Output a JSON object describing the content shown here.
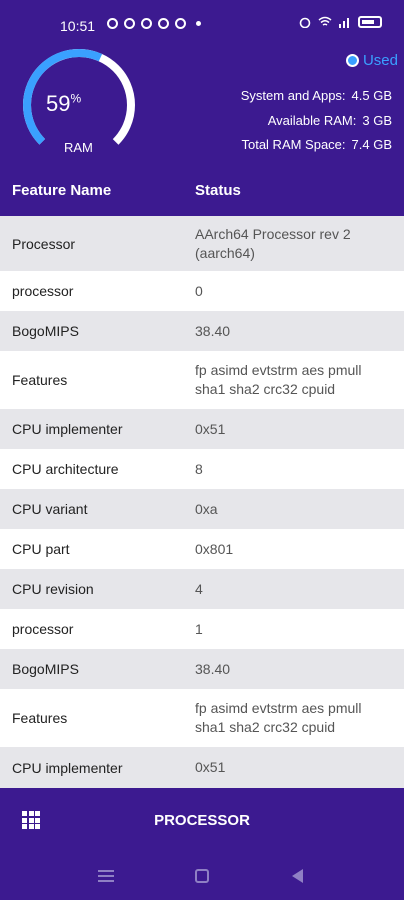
{
  "status_bar": {
    "time": "10:51",
    "icons": [
      "play-icon",
      "messenger-icon",
      "tiktok-icon",
      "instagram-icon",
      "pinterest-icon",
      "dot-icon"
    ],
    "right_icons": [
      "alarm-icon",
      "wifi-icon",
      "signal-icon",
      "battery-icon"
    ]
  },
  "ram": {
    "percent_number": "59",
    "percent_sign": "%",
    "label": "RAM",
    "used_fraction": 0.59,
    "used_label": "Used",
    "system_apps_label": "System and Apps:",
    "system_apps_value": "4.5 GB",
    "available_label": "Available RAM:",
    "available_value": "3 GB",
    "total_label": "Total RAM Space:",
    "total_value": "7.4 GB"
  },
  "table": {
    "headers": [
      "Feature Name",
      "Status"
    ],
    "rows": [
      {
        "name": "Processor",
        "value": "AArch64 Processor rev 2 (aarch64)"
      },
      {
        "name": "processor",
        "value": "0"
      },
      {
        "name": "BogoMIPS",
        "value": "38.40"
      },
      {
        "name": "Features",
        "value": "fp asimd evtstrm aes pmull sha1 sha2 crc32 cpuid"
      },
      {
        "name": "CPU implementer",
        "value": "0x51"
      },
      {
        "name": "CPU architecture",
        "value": "8"
      },
      {
        "name": "CPU variant",
        "value": "0xa"
      },
      {
        "name": "CPU part",
        "value": "0x801"
      },
      {
        "name": "CPU revision",
        "value": "4"
      },
      {
        "name": "processor",
        "value": "1"
      },
      {
        "name": "BogoMIPS",
        "value": "38.40"
      },
      {
        "name": "Features",
        "value": "fp asimd evtstrm aes pmull sha1 sha2 crc32 cpuid"
      },
      {
        "name": "CPU implementer",
        "value": "0x51"
      }
    ]
  },
  "footer": {
    "title": "PROCESSOR",
    "menu_icon": "grid-icon"
  },
  "colors": {
    "primary": "#3c1a90",
    "accent": "#3aa0ff",
    "row_alt": "#e6e6ea"
  }
}
